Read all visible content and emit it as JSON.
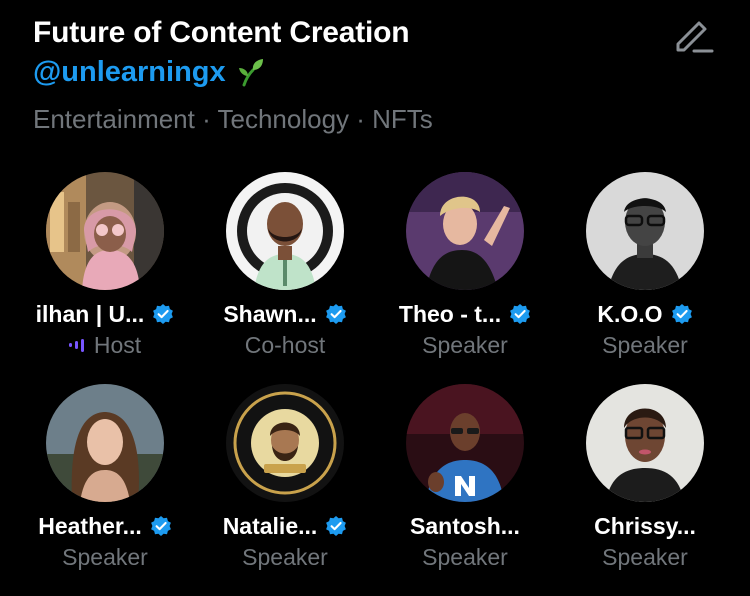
{
  "space": {
    "title": "Future of Content Creation",
    "host_handle": "@unlearningx",
    "topics": "Entertainment · Technology · NFTs"
  },
  "colors": {
    "accent": "#1d9bf0",
    "speaking": "#7856ff",
    "muted": "#71767b"
  },
  "icons": {
    "edit": "edit-pencil-icon",
    "verified": "verified-badge-icon",
    "sprout": "seedling-icon"
  },
  "participants": [
    {
      "name": "ilhan | U...",
      "role": "Host",
      "verified": true,
      "speaking": true
    },
    {
      "name": "Shawn...",
      "role": "Co-host",
      "verified": true,
      "speaking": false
    },
    {
      "name": "Theo - t...",
      "role": "Speaker",
      "verified": true,
      "speaking": false
    },
    {
      "name": "K.O.O",
      "role": "Speaker",
      "verified": true,
      "speaking": false
    },
    {
      "name": "Heather...",
      "role": "Speaker",
      "verified": true,
      "speaking": false
    },
    {
      "name": "Natalie...",
      "role": "Speaker",
      "verified": true,
      "speaking": false
    },
    {
      "name": "Santosh...",
      "role": "Speaker",
      "verified": false,
      "speaking": false
    },
    {
      "name": "Chrissy...",
      "role": "Speaker",
      "verified": false,
      "speaking": false
    }
  ]
}
